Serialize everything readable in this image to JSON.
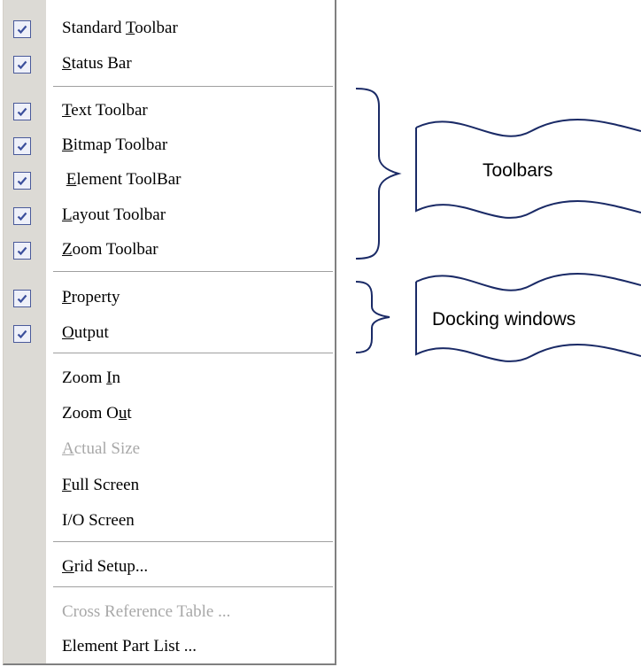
{
  "menu": {
    "items": [
      {
        "pre": "Standard ",
        "u": "T",
        "post": "oolbar",
        "checked": true,
        "disabled": false
      },
      {
        "pre": "",
        "u": "S",
        "post": "tatus Bar",
        "checked": true,
        "disabled": false
      },
      {
        "pre": "",
        "u": "T",
        "post": "ext Toolbar",
        "checked": true,
        "disabled": false
      },
      {
        "pre": "",
        "u": "B",
        "post": "itmap Toolbar",
        "checked": true,
        "disabled": false
      },
      {
        "pre": " ",
        "u": "E",
        "post": "lement ToolBar",
        "checked": true,
        "disabled": false
      },
      {
        "pre": "",
        "u": "L",
        "post": "ayout Toolbar",
        "checked": true,
        "disabled": false
      },
      {
        "pre": "",
        "u": "Z",
        "post": "oom Toolbar",
        "checked": true,
        "disabled": false
      },
      {
        "pre": "",
        "u": "P",
        "post": "roperty",
        "checked": true,
        "disabled": false
      },
      {
        "pre": "",
        "u": "O",
        "post": "utput",
        "checked": true,
        "disabled": false
      },
      {
        "pre": "Zoom ",
        "u": "I",
        "post": "n",
        "checked": false,
        "disabled": false
      },
      {
        "pre": "Zoom O",
        "u": "u",
        "post": "t",
        "checked": false,
        "disabled": false
      },
      {
        "pre": "",
        "u": "A",
        "post": "ctual Size",
        "checked": false,
        "disabled": true
      },
      {
        "pre": "",
        "u": "F",
        "post": "ull Screen",
        "checked": false,
        "disabled": false
      },
      {
        "pre": "I/O Screen",
        "u": "",
        "post": "",
        "checked": false,
        "disabled": false
      },
      {
        "pre": "",
        "u": "G",
        "post": "rid Setup...",
        "checked": false,
        "disabled": false
      },
      {
        "pre": "Cross Reference Table ...",
        "u": "",
        "post": "",
        "checked": false,
        "disabled": true
      },
      {
        "pre": "Element Part List ...",
        "u": "",
        "post": "",
        "checked": false,
        "disabled": false
      }
    ]
  },
  "annotations": {
    "toolbars_label": "Toolbars",
    "docking_label": "Docking windows"
  },
  "colors": {
    "gutter": "#dcdad5",
    "check_border": "#4a5a9a",
    "check_mark": "#3b4f9c",
    "disabled_text": "#a8a8a8",
    "annotation_stroke": "#1a2a66"
  }
}
